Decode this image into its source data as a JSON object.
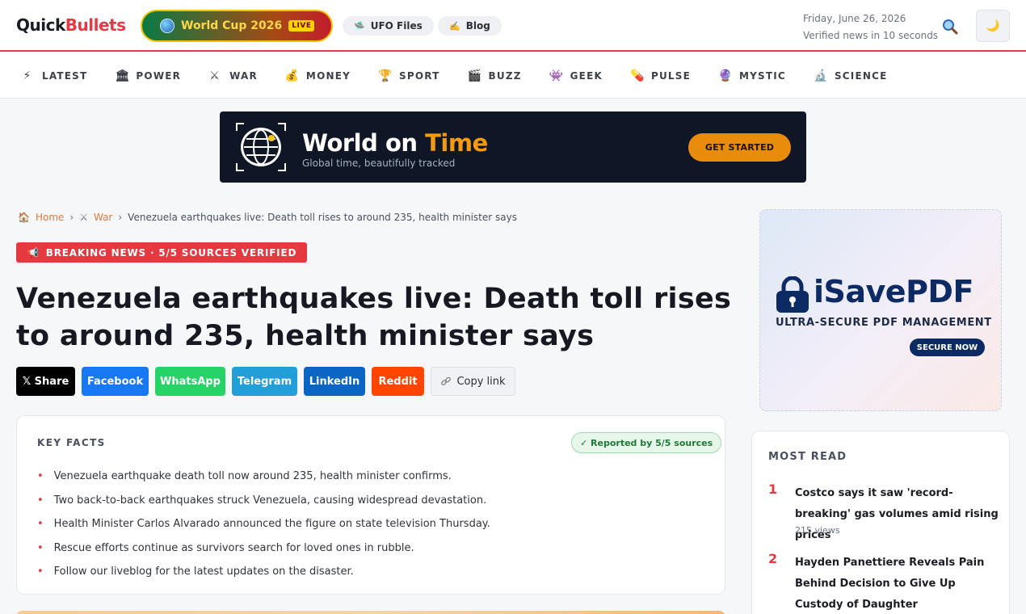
{
  "header": {
    "logo_a": "Quick",
    "logo_b": "Bullets",
    "worldcup_label": "World Cup 2026",
    "live_badge": "LIVE",
    "ufo_label": "UFO Files",
    "blog_label": "Blog",
    "date": "Friday, June 26, 2026",
    "tagline": "Verified news in 10 seconds",
    "ufo_icon": "🛸",
    "blog_icon": "✍️",
    "moon_icon": "🌙"
  },
  "nav": [
    {
      "icon": "⚡",
      "label": "LATEST"
    },
    {
      "icon": "🏛",
      "label": "POWER"
    },
    {
      "icon": "⚔",
      "label": "WAR"
    },
    {
      "icon": "💰",
      "label": "MONEY"
    },
    {
      "icon": "🏆",
      "label": "SPORT"
    },
    {
      "icon": "🎬",
      "label": "BUZZ"
    },
    {
      "icon": "👾",
      "label": "GEEK"
    },
    {
      "icon": "💊",
      "label": "PULSE"
    },
    {
      "icon": "🔮",
      "label": "MYSTIC"
    },
    {
      "icon": "🔬",
      "label": "SCIENCE"
    }
  ],
  "banner": {
    "title_a": "World on ",
    "title_b": "Time",
    "subtitle": "Global time, beautifully tracked",
    "cta": "GET STARTED"
  },
  "breadcrumb": {
    "home_icon": "🏠",
    "home": "Home",
    "sep": "›",
    "section_icon": "⚔",
    "section": "War",
    "current": "Venezuela earthquakes live: Death toll rises to around 235, health minister says"
  },
  "article": {
    "breaking_icon": "📢",
    "breaking": "BREAKING NEWS · 5/5 SOURCES VERIFIED",
    "title": "Venezuela earthquakes live: Death toll rises to around 235, health minister says"
  },
  "share": {
    "x": "𝕏 Share",
    "facebook": "Facebook",
    "whatsapp": "WhatsApp",
    "telegram": "Telegram",
    "linkedin": "LinkedIn",
    "reddit": "Reddit",
    "copy": "Copy link",
    "colors": {
      "x": "#000000",
      "facebook": "#1877f2",
      "whatsapp": "#25d366",
      "telegram": "#229ed9",
      "linkedin": "#0a66c2",
      "reddit": "#ff4500"
    }
  },
  "key_facts": {
    "heading": "KEY FACTS",
    "badge": "✓ Reported by 5/5 sources",
    "items": [
      "Venezuela earthquake death toll now around 235, health minister confirms.",
      "Two back-to-back earthquakes struck Venezuela, causing widespread devastation.",
      "Health Minister Carlos Alvarado announced the figure on state television Thursday.",
      "Rescue efforts continue as survivors search for loved ones in rubble.",
      "Follow our liveblog for the latest updates on the disaster."
    ]
  },
  "sidebar_ad": {
    "brand": "iSavePDF",
    "tagline": "ULTRA-SECURE PDF MANAGEMENT",
    "cta": "SECURE NOW"
  },
  "most_read": {
    "heading": "MOST READ",
    "items": [
      {
        "rank": "1",
        "title": "Costco says it saw 'record-breaking' gas volumes amid rising prices",
        "views": "215 views"
      },
      {
        "rank": "2",
        "title": "Hayden Panettiere Reveals Pain Behind Decision to Give Up Custody of Daughter",
        "views": ""
      }
    ]
  }
}
